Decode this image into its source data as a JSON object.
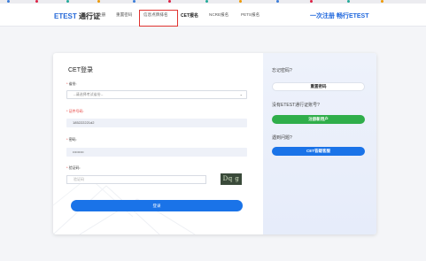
{
  "header": {
    "brand_name": "ETEST",
    "brand_suffix": "通行证",
    "nav": [
      {
        "label": "注册"
      },
      {
        "label": "重置密码"
      },
      {
        "label": "信息点牌排名"
      },
      {
        "label": "CET报名"
      },
      {
        "label": "NCRE报名"
      },
      {
        "label": "PETS报名"
      }
    ],
    "slogan": "一次注册 畅行ETEST"
  },
  "login": {
    "title": "CET登录",
    "province_label": "省份:",
    "province_value": "--请选择考试省份--",
    "id_label": "证件号码:",
    "id_value": "185222221d2",
    "password_label": "密码:",
    "password_value": "•••••••••",
    "captcha_label": "验证码:",
    "captcha_placeholder": "验证码",
    "captcha_image_text": "Dq g",
    "submit_label": "登录"
  },
  "side": {
    "forgot_text": "忘记密码?",
    "reset_button": "重置密码",
    "no_account_text": "没有ETEST通行证账号?",
    "register_button": "注册新用户",
    "problem_text": "遇到问题?",
    "help_button": "CET答疑客服"
  },
  "colors": {
    "brand_blue": "#1a73e8",
    "green": "#2fae4a",
    "error_red": "#e53935",
    "highlight_red": "#e0322f"
  }
}
